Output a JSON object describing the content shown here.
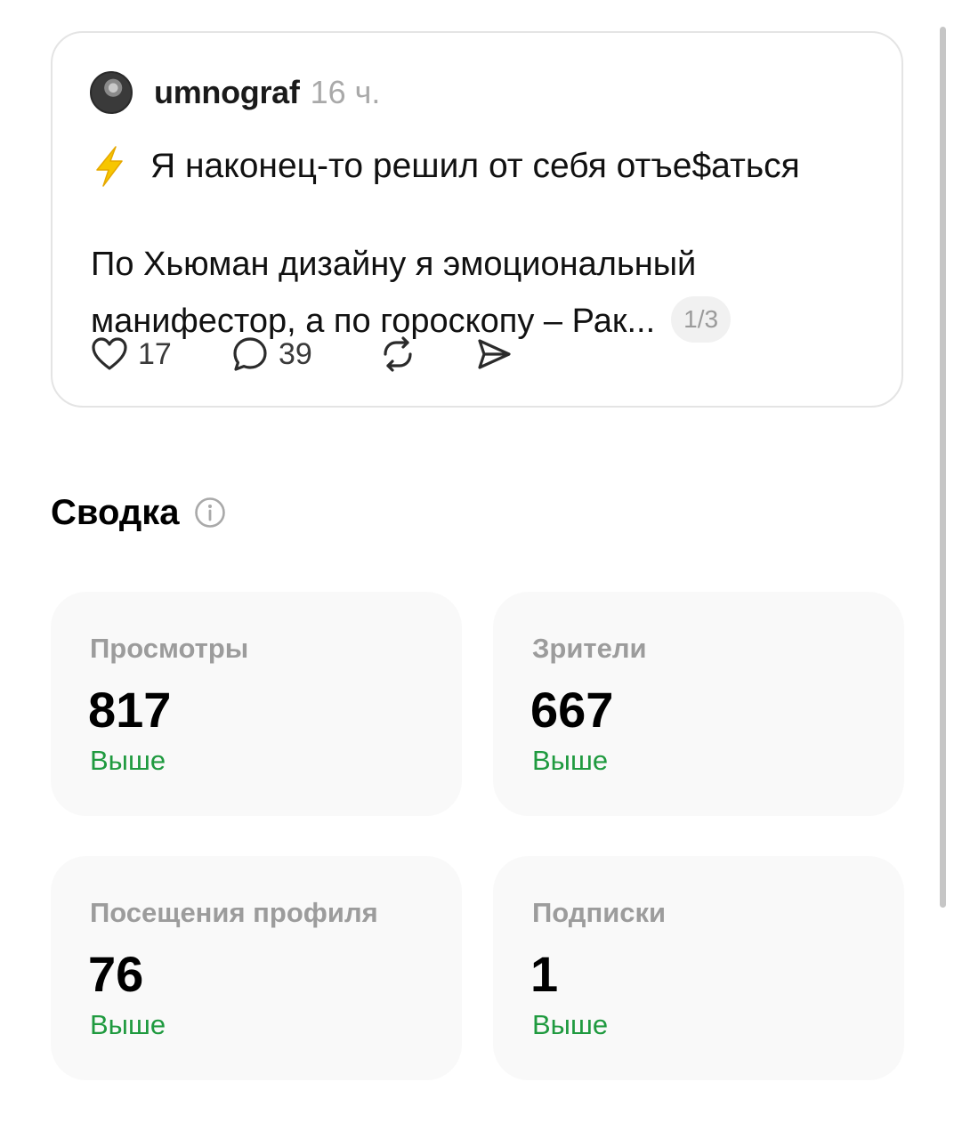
{
  "post": {
    "username": "umnograf",
    "time": "16 ч.",
    "title": "Я наконец-то решил от себя отъе$аться",
    "body": "По Хьюман дизайну я эмоциональный манифестор, а по гороскопу – Рак...",
    "page_indicator": "1/3",
    "likes": "17",
    "replies": "39"
  },
  "summary": {
    "title": "Сводка",
    "stats": [
      {
        "label": "Просмотры",
        "value": "817",
        "trend": "Выше"
      },
      {
        "label": "Зрители",
        "value": "667",
        "trend": "Выше"
      },
      {
        "label": "Посещения профиля",
        "value": "76",
        "trend": "Выше"
      },
      {
        "label": "Подписки",
        "value": "1",
        "trend": "Выше"
      }
    ]
  },
  "icons": [
    "avatar",
    "lightning-icon",
    "heart-icon",
    "comment-icon",
    "repost-icon",
    "share-icon",
    "info-icon"
  ],
  "colors": {
    "trend_positive": "#1f9a3f",
    "muted_text": "#9c9c9c",
    "card_bg": "#f9f9f9",
    "accent_bolt": "#f5c000"
  }
}
